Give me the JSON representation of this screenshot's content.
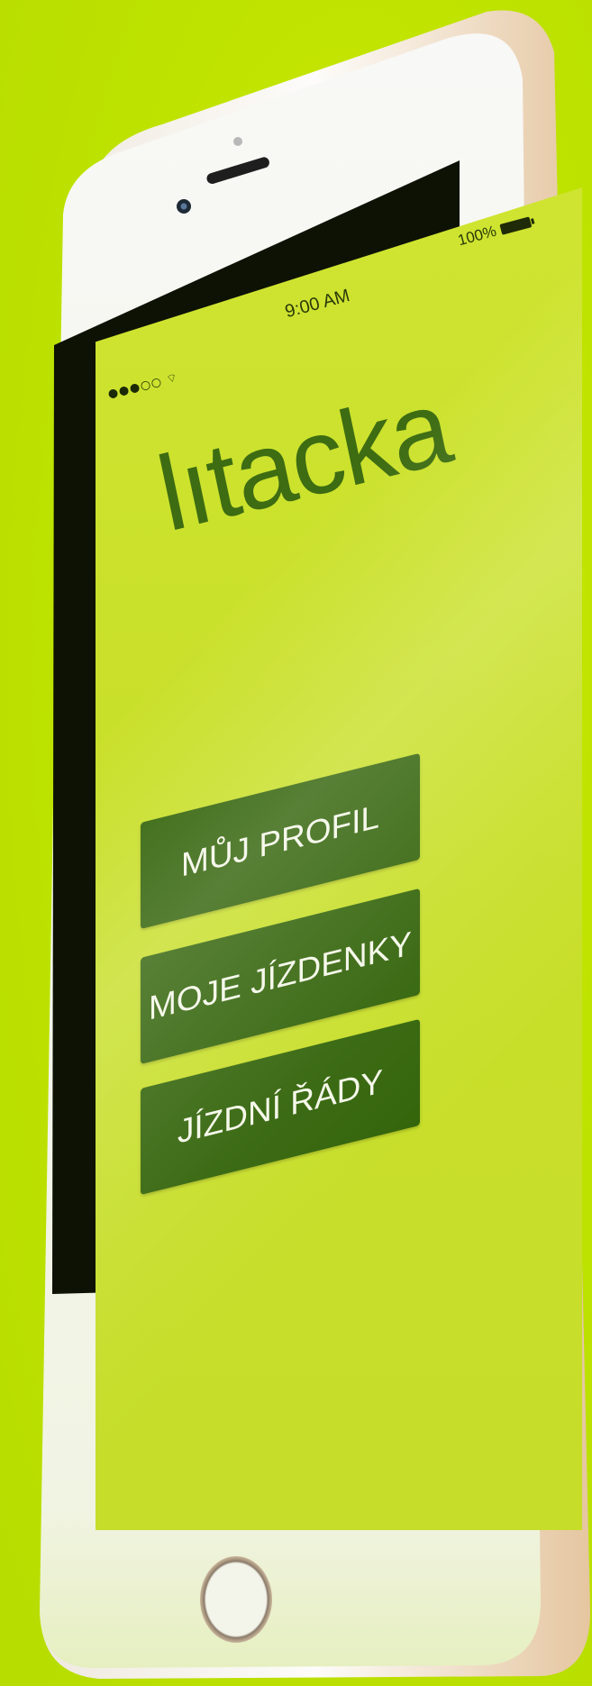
{
  "status_bar": {
    "signal": "●●●○○",
    "wifi_icon": "wifi-icon",
    "time": "9:00 AM",
    "battery_percent": "100%",
    "battery_icon": "battery-icon"
  },
  "app": {
    "logo_text_left": "l",
    "logo_text_right": "tacka",
    "logo_colors": {
      "main": "#3d6c12",
      "accent": "#ffffff"
    }
  },
  "menu": {
    "items": [
      {
        "label": "MŮJ PROFIL"
      },
      {
        "label": "MOJE JÍZDENKY"
      },
      {
        "label": "JÍZDNÍ ŘÁDY"
      }
    ]
  },
  "colors": {
    "background": "#c4e600",
    "screen": "#cbe12c",
    "button": "#33640a",
    "button_text": "#f4f7e8",
    "phone_frame": "#f7f7f5",
    "phone_edge": "#e7c9a4"
  }
}
